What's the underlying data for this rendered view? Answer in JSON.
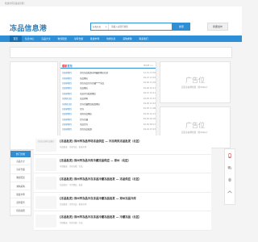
{
  "topbar": {
    "welcome": "欢迎访问冻品信息港！"
  },
  "header": {
    "logo": "冻品信息港",
    "search_select": "分类信息",
    "search_placeholder": "请输入关键字搜索",
    "search_button": "搜索",
    "post_button": "我要发布"
  },
  "nav": {
    "items": [
      "首页",
      "信息中心",
      "冻品大全",
      "物流配送",
      "冷库仓储",
      "批发市场",
      "供求信息",
      "采购求购",
      "联系我们"
    ]
  },
  "news": {
    "title_a": "最新",
    "title_b": "发布",
    "more": "MORE >>",
    "items": [
      {
        "cat": "[全国地区]",
        "txt": "冷库冻品批发市场最新供应信息",
        "date": "12-31 21:59"
      },
      {
        "cat": "[全国地区]",
        "txt": "冻品供应",
        "date": "09-07 13:43"
      },
      {
        "cat": "[全国地区]",
        "txt": "冷库冻品冷冻冷藏****冻品",
        "date": "09-06 11:03"
      },
      {
        "cat": "[全国地区]",
        "txt": "冻品供应",
        "date": "09-06 10:11"
      },
      {
        "cat": "[全国地区]",
        "txt": "冻品冷冻批发供应",
        "date": "09-07 10:11"
      },
      {
        "cat": "[采购信息]",
        "txt": "冻品求购",
        "date": "09-05 15:57"
      },
      {
        "cat": "[采购信息]",
        "txt": "冷冻冷藏食品批发供应",
        "date": "09-05 13:43"
      },
      {
        "cat": "[全国地区]",
        "txt": "冷冻",
        "date": "09-05 11:08"
      },
      {
        "cat": "[全国地区]",
        "txt": "冻肉冻品供应",
        "date": "09-05 10:21"
      },
      {
        "cat": "[全国地区]",
        "txt": "冷冻冷藏",
        "date": "09-05 09:02"
      },
      {
        "cat": "[全国地区]",
        "txt": "冻品冷冻",
        "date": "09-05 08:12"
      },
      {
        "cat": "[全国地区]",
        "txt": "冷库冻品批发",
        "date": "09-04 13:43"
      }
    ]
  },
  "ads": {
    "title": "广告位",
    "size": "首页主右侧位置（宽300px）"
  },
  "side": {
    "head": "热门分类",
    "items": [
      "冻品大全",
      "冷库仓储",
      "物流配送",
      "求购采购",
      "批发市场",
      "商务服务",
      "招商加盟"
    ]
  },
  "feed": {
    "items": [
      {
        "thumb": "冻品信息港冻品图片",
        "title": "[冻品批发] 郑州市冻品市场冻品供应 — 冷冻肉类冻品批发（北区）",
        "sub": "冻品批发 · 冷库冻品 · 批发市场"
      },
      {
        "title": "[冻品批发] 郑州市冻品冷库冷藏冻品供应 — 郑州（北区）",
        "sub": "冷链配送 · 冷库仓储 · 冻品"
      },
      {
        "title": "[冻品批发] 郑州市冻品冷冻冻品冷藏冻品批发 — 冻品供应（北区）",
        "sub": "冻品供应 · 冷冻食品 · 批发"
      },
      {
        "title": "[冻品批发] 郑州市冻品冷冻冻品冷藏冻品批发 — 郑州冻品冷库",
        "sub": "冻品批发 · 冷库冻品 · 批发市场"
      },
      {
        "title": "[冻品批发] 郑州市冻品冷冻冻品冷藏冻品批发 — 冷藏冻品（北区）",
        "sub": "冷链配送 · 冷库仓储 · 冻品"
      }
    ]
  },
  "float_bar": {
    "icons": [
      "phone-icon",
      "wechat-icon",
      "qq-icon",
      "top-icon"
    ]
  },
  "colors": {
    "accent": "#2e8fd6",
    "logo": "#2e7db8",
    "highlight": "#e33"
  }
}
